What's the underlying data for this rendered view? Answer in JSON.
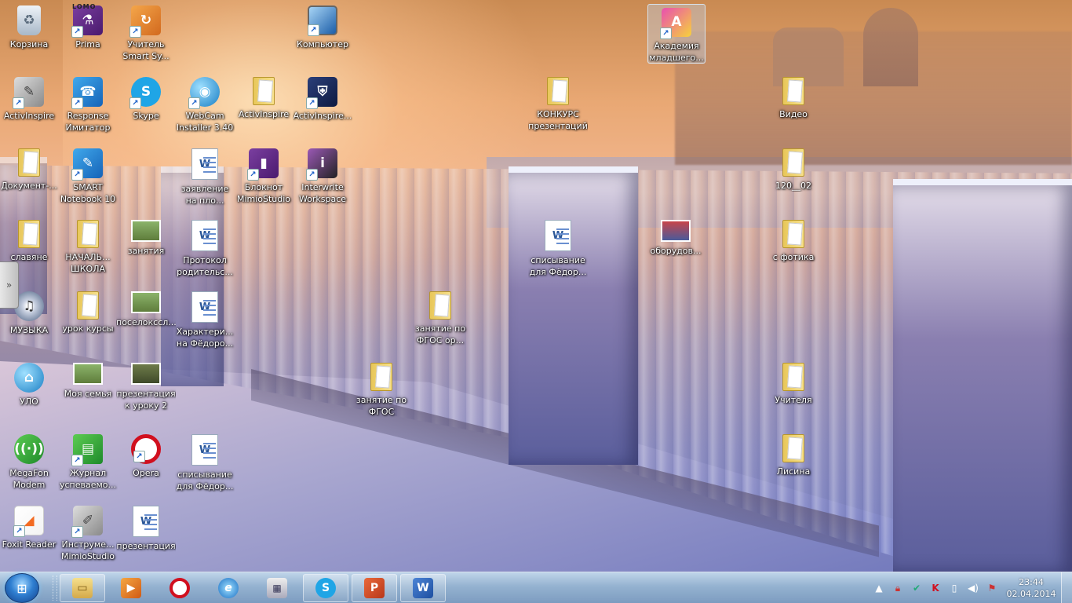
{
  "desktop": {
    "icons": [
      {
        "label": "Корзина",
        "icon": "recycle-bin-icon"
      },
      {
        "label": "Prima",
        "icon": "microscope-icon",
        "badge": "LOMO"
      },
      {
        "label": "Учитель Smart Sy...",
        "icon": "teacher-app-icon"
      },
      {
        "label": "Компьютер",
        "icon": "computer-icon"
      },
      {
        "label": "Академия младшего...",
        "icon": "academy-icon"
      },
      {
        "label": "ActivInspire",
        "icon": "activinspire-icon"
      },
      {
        "label": "Response Имитатор",
        "icon": "phone-icon"
      },
      {
        "label": "Skype",
        "icon": "skype-icon"
      },
      {
        "label": "WebCam Installer 3.40",
        "icon": "webcam-icon"
      },
      {
        "label": "ActivInspire",
        "icon": "folder-icon"
      },
      {
        "label": "ActivInspire...",
        "icon": "installer-icon"
      },
      {
        "label": "КОНКУРС презентаций",
        "icon": "folder-icon"
      },
      {
        "label": "Видео",
        "icon": "folder-icon"
      },
      {
        "label": "Документ-...",
        "icon": "folder-icon"
      },
      {
        "label": "SMART Notebook 10",
        "icon": "smart-notebook-icon"
      },
      {
        "label": "заявление на пло...",
        "icon": "word-document-icon"
      },
      {
        "label": "Блокнот MimioStudio",
        "icon": "notebook-icon"
      },
      {
        "label": "Interwrite Workspace",
        "icon": "interwrite-icon"
      },
      {
        "label": "120__02",
        "icon": "folder-icon"
      },
      {
        "label": "славяне",
        "icon": "folder-icon"
      },
      {
        "label": "НАЧАЛЬ... ШКОЛА",
        "icon": "folder-icon"
      },
      {
        "label": "занятия",
        "icon": "image-file-icon"
      },
      {
        "label": "Протокол родительс...",
        "icon": "word-document-icon"
      },
      {
        "label": "списывание для Фёдор...",
        "icon": "word-document-icon"
      },
      {
        "label": "оборудов...",
        "icon": "image-file-icon"
      },
      {
        "label": "с фотика",
        "icon": "folder-icon"
      },
      {
        "label": "МУЗЫКА",
        "icon": "music-disc-icon"
      },
      {
        "label": "урок курсы",
        "icon": "folder-icon"
      },
      {
        "label": "поселокссл...",
        "icon": "image-file-icon"
      },
      {
        "label": "Характери... на Фёдоро...",
        "icon": "word-document-icon"
      },
      {
        "label": "занятие по ФГОС ор...",
        "icon": "folder-icon"
      },
      {
        "label": "УЛО",
        "icon": "network-computer-icon"
      },
      {
        "label": "Моя семья",
        "icon": "image-file-icon"
      },
      {
        "label": "презентация к уроку 2",
        "icon": "image-file-icon"
      },
      {
        "label": "занятие по ФГОС",
        "icon": "folder-icon"
      },
      {
        "label": "Учителя",
        "icon": "folder-icon"
      },
      {
        "label": "MegaFon Modem",
        "icon": "megafon-modem-icon"
      },
      {
        "label": "Журнал успеваемо...",
        "icon": "journal-icon"
      },
      {
        "label": "Opera",
        "icon": "opera-icon"
      },
      {
        "label": "списывание для Фёдор...",
        "icon": "word-document-icon"
      },
      {
        "label": "Лисина",
        "icon": "folder-icon"
      },
      {
        "label": "Foxit Reader",
        "icon": "foxit-reader-icon"
      },
      {
        "label": "Инструме... MimioStudio",
        "icon": "mimio-tools-icon"
      },
      {
        "label": "презентация",
        "icon": "word-document-icon"
      }
    ]
  },
  "taskbar": {
    "start_icon": "windows-logo-icon",
    "pinned": [
      {
        "name": "explorer-taskbar-button",
        "icon": "folder-icon",
        "active": true
      },
      {
        "name": "media-player-taskbar-button",
        "icon": "media-player-icon",
        "active": false
      },
      {
        "name": "opera-taskbar-button",
        "icon": "opera-icon",
        "active": false
      },
      {
        "name": "ie-taskbar-button",
        "icon": "internet-explorer-icon",
        "active": false
      },
      {
        "name": "calculator-taskbar-button",
        "icon": "calculator-icon",
        "active": false
      },
      {
        "name": "skype-taskbar-button",
        "icon": "skype-icon",
        "active": true
      },
      {
        "name": "powerpoint-taskbar-button",
        "icon": "powerpoint-icon",
        "active": true
      },
      {
        "name": "word-taskbar-button",
        "icon": "word-icon",
        "active": true
      }
    ],
    "tray_icons": [
      "show-hidden-icons-icon",
      "lock-icon",
      "safely-remove-icon",
      "kaspersky-icon",
      "network-icon",
      "volume-icon",
      "flag-icon"
    ],
    "clock": {
      "time": "23:44",
      "date": "02.04.2014"
    }
  }
}
